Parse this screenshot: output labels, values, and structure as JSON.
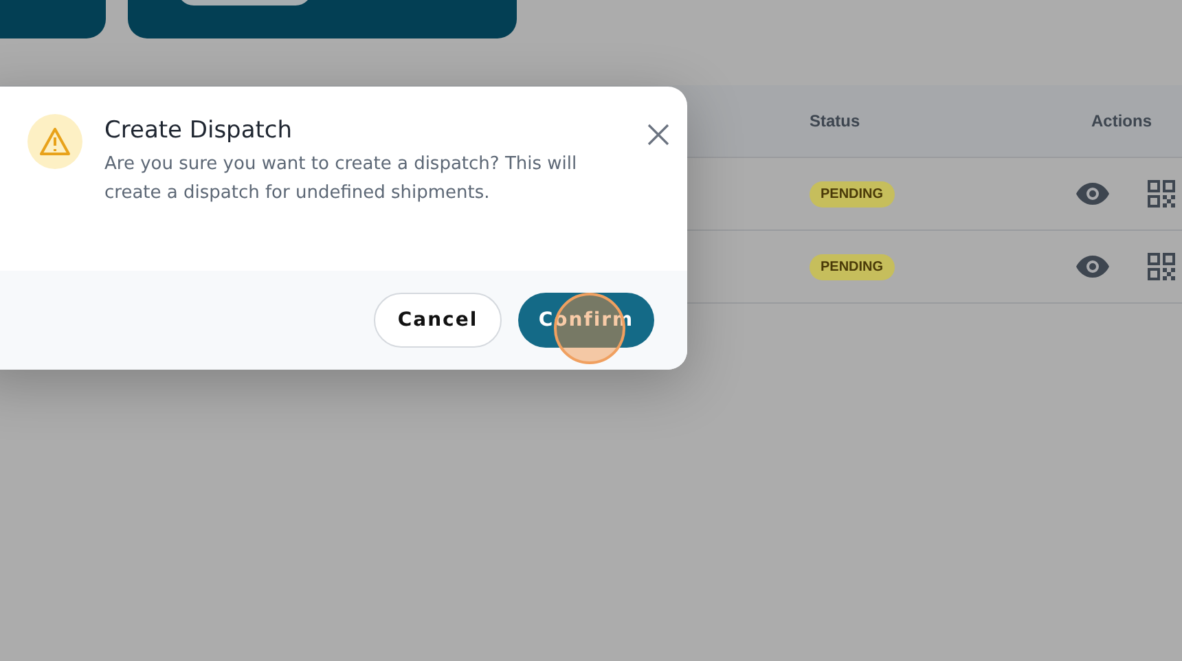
{
  "table": {
    "columns": [
      "Status",
      "Actions"
    ],
    "rows": [
      {
        "status": "PENDING"
      },
      {
        "status": "PENDING"
      }
    ]
  },
  "dialog": {
    "title": "Create Dispatch",
    "message": "Are you sure you want to create a dispatch? This will create a dispatch for undefined shipments.",
    "buttons": [
      {
        "label": "Cancel",
        "kind": "secondary"
      },
      {
        "label": "Confirm",
        "kind": "primary"
      }
    ]
  }
}
